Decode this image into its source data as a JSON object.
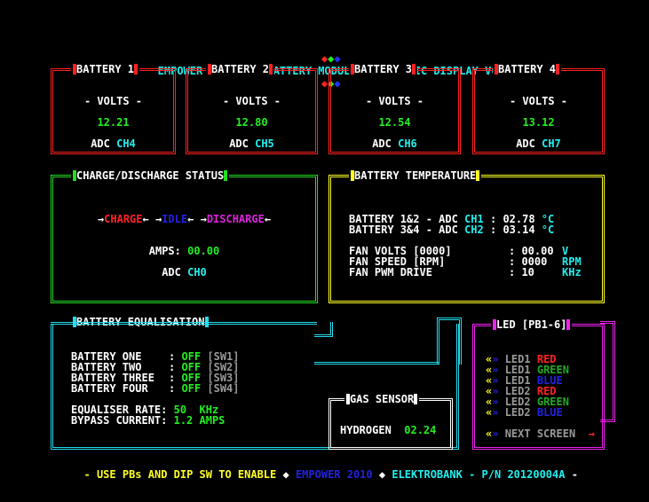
{
  "header": {
    "title": "EMPOWER ENERGY - BATTERY MODULE DIAGNOSTIC DISPLAY V01"
  },
  "batteries": [
    {
      "title": "BATTERY 1",
      "volts_label": "- VOLTS -",
      "volts": "12.21",
      "adc_label": "ADC",
      "channel": "CH4"
    },
    {
      "title": "BATTERY 2",
      "volts_label": "- VOLTS -",
      "volts": "12.80",
      "adc_label": "ADC",
      "channel": "CH5"
    },
    {
      "title": "BATTERY 3",
      "volts_label": "- VOLTS -",
      "volts": "12.54",
      "adc_label": "ADC",
      "channel": "CH6"
    },
    {
      "title": "BATTERY 4",
      "volts_label": "- VOLTS -",
      "volts": "13.12",
      "adc_label": "ADC",
      "channel": "CH7"
    }
  ],
  "charge": {
    "title": "CHARGE/DISCHARGE STATUS",
    "mode_charge": "CHARGE",
    "mode_idle": "IDLE",
    "mode_discharge": "DISCHARGE",
    "amps_label": "AMPS:",
    "amps_value": "00.00",
    "adc_label": "ADC",
    "adc_channel": "CH0"
  },
  "temperature": {
    "title": "BATTERY TEMPERATURE",
    "rows": [
      {
        "label": "BATTERY 1&2 - ADC",
        "channel": "CH1",
        "value": "02.78",
        "unit": "°C"
      },
      {
        "label": "BATTERY 3&4 - ADC",
        "channel": "CH2",
        "value": "03.14",
        "unit": "°C"
      }
    ],
    "fan": [
      {
        "label": "FAN VOLTS [0000]",
        "value": "00.00",
        "unit": "V"
      },
      {
        "label": "FAN SPEED [RPM]",
        "value": "0000",
        "unit": "RPM"
      },
      {
        "label": "FAN PWM DRIVE",
        "value": "10",
        "unit": "KHz"
      }
    ]
  },
  "equalisation": {
    "title": "BATTERY EQUALISATION",
    "rows": [
      {
        "label": "BATTERY ONE",
        "state": "OFF",
        "switch": "[SW1]"
      },
      {
        "label": "BATTERY TWO",
        "state": "OFF",
        "switch": "[SW2]"
      },
      {
        "label": "BATTERY THREE",
        "state": "OFF",
        "switch": "[SW3]"
      },
      {
        "label": "BATTERY FOUR",
        "state": "OFF",
        "switch": "[SW4]"
      }
    ],
    "rate_label": "EQUALISER RATE:",
    "rate_value": "50",
    "rate_unit": "KHz",
    "bypass_label": "BYPASS CURRENT:",
    "bypass_value": "1.2 AMPS"
  },
  "gas": {
    "title": "GAS SENSOR",
    "label": "HYDROGEN",
    "value": "02.24"
  },
  "leds": {
    "title": "LED [PB1-6]",
    "items": [
      {
        "name": "LED1",
        "color": "RED"
      },
      {
        "name": "LED1",
        "color": "GREEN"
      },
      {
        "name": "LED1",
        "color": "BLUE"
      },
      {
        "name": "LED2",
        "color": "RED"
      },
      {
        "name": "LED2",
        "color": "GREEN"
      },
      {
        "name": "LED2",
        "color": "BLUE"
      }
    ],
    "next_label": "NEXT SCREEN",
    "next_arrow": "→"
  },
  "footer": {
    "instructions": "USE PBs AND DIP SW TO ENABLE",
    "brand": "EMPOWER 2010",
    "maker": "ELEKTROBANK",
    "part_number": "P/N 20120004A"
  },
  "colors": {
    "background": "#000000",
    "battery_frame": "#ff2020",
    "charge_frame": "#22dd22",
    "temperature_frame": "#ffff22",
    "equalisation_frame": "#22ddee",
    "gas_frame": "#ffffff",
    "led_frame": "#ee22ee"
  }
}
